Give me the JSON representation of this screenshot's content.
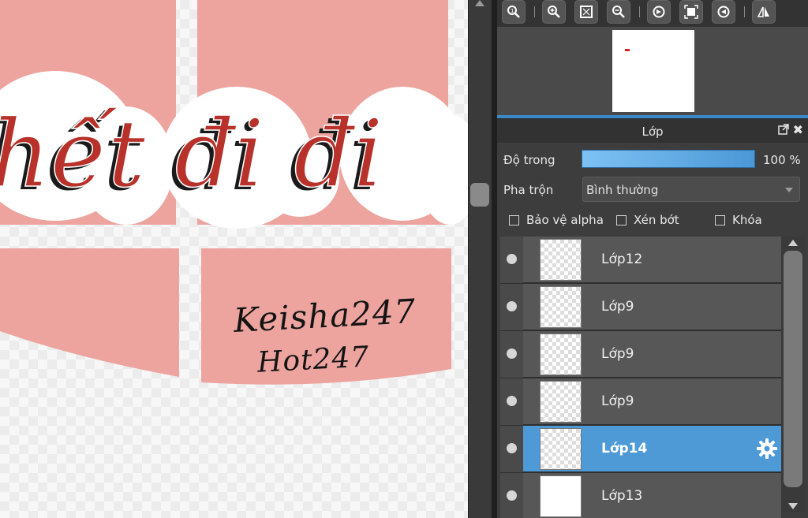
{
  "canvas": {
    "big_text": "hết đi đi",
    "handwriting_line1": "Keisha247",
    "handwriting_line2": "Hot247",
    "colors": {
      "pink": "#eda49f",
      "red": "#b8312a",
      "white": "#ffffff"
    }
  },
  "toolbar": {
    "icons": [
      "zoom-icon",
      "zoom-in-icon",
      "fit-screen-icon",
      "zoom-out-icon",
      "rotate-left-icon",
      "fullscreen-icon",
      "rotate-right-icon",
      "flip-icon"
    ]
  },
  "layers_panel": {
    "title": "Lớp",
    "opacity_label": "Độ trong",
    "opacity_value": "100 %",
    "opacity_fraction": 1.0,
    "blend_label": "Pha trộn",
    "blend_value": "Bình thường",
    "checkbox_alpha": "Bảo vệ alpha",
    "checkbox_clip": "Xén bớt",
    "checkbox_lock": "Khóa",
    "layers": [
      {
        "name": "Lớp12",
        "selected": false,
        "thumb": "transparent"
      },
      {
        "name": "Lớp9",
        "selected": false,
        "thumb": "transparent"
      },
      {
        "name": "Lớp9",
        "selected": false,
        "thumb": "transparent"
      },
      {
        "name": "Lớp9",
        "selected": false,
        "thumb": "transparent"
      },
      {
        "name": "Lớp14",
        "selected": true,
        "thumb": "transparent"
      },
      {
        "name": "Lớp13",
        "selected": false,
        "thumb": "white"
      }
    ],
    "accent_color": "#4d9ad6"
  }
}
